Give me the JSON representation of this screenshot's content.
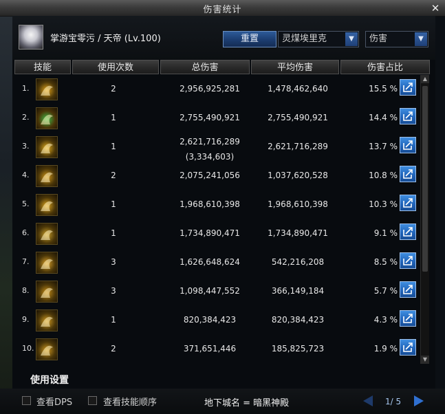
{
  "window": {
    "title": "伤害统计",
    "close_label": "✕"
  },
  "header": {
    "character": "掌游宝零污 / 天帝 (Lv.100)",
    "reset_label": "重置",
    "target_select": "灵煤埃里克",
    "metric_select": "伤害",
    "dropdown_arrow": "▼"
  },
  "table": {
    "columns": [
      "技能",
      "使用次数",
      "总伤害",
      "平均伤害",
      "伤害占比"
    ],
    "rows": [
      {
        "rank": "1.",
        "uses": "2",
        "total": "2,956,925,281",
        "total_extra": "",
        "avg": "1,478,462,640",
        "pct": "15.5 %",
        "icon": "flame-slash-icon",
        "color": "#e2a51c"
      },
      {
        "rank": "2.",
        "uses": "1",
        "total": "2,755,490,921",
        "total_extra": "",
        "avg": "2,755,490,921",
        "pct": "14.4 %",
        "icon": "green-lightning-icon",
        "color": "#3fc04a"
      },
      {
        "rank": "3.",
        "uses": "1",
        "total": "2,621,716,289",
        "total_extra": "(3,334,603)",
        "avg": "2,621,716,289",
        "pct": "13.7 %",
        "icon": "storm-strike-icon",
        "color": "#e6b020"
      },
      {
        "rank": "4.",
        "uses": "2",
        "total": "2,075,241,056",
        "total_extra": "",
        "avg": "1,037,620,528",
        "pct": "10.8 %",
        "icon": "wave-arrow-icon",
        "color": "#d49a1a"
      },
      {
        "rank": "5.",
        "uses": "1",
        "total": "1,968,610,398",
        "total_extra": "",
        "avg": "1,968,610,398",
        "pct": "10.3 %",
        "icon": "crown-burst-icon",
        "color": "#e0a820"
      },
      {
        "rank": "6.",
        "uses": "1",
        "total": "1,734,890,471",
        "total_extra": "",
        "avg": "1,734,890,471",
        "pct": "9.1 %",
        "icon": "triple-wave-icon",
        "color": "#caa02a"
      },
      {
        "rank": "7.",
        "uses": "3",
        "total": "1,626,648,624",
        "total_extra": "",
        "avg": "542,216,208",
        "pct": "8.5 %",
        "icon": "pillar-glow-icon",
        "color": "#dca22a"
      },
      {
        "rank": "8.",
        "uses": "3",
        "total": "1,098,447,552",
        "total_extra": "",
        "avg": "366,149,184",
        "pct": "5.7 %",
        "icon": "rune-circle-icon",
        "color": "#c99018"
      },
      {
        "rank": "9.",
        "uses": "1",
        "total": "820,384,423",
        "total_extra": "",
        "avg": "820,384,423",
        "pct": "4.3 %",
        "icon": "sun-face-icon",
        "color": "#d6a024"
      },
      {
        "rank": "10.",
        "uses": "2",
        "total": "371,651,446",
        "total_extra": "",
        "avg": "185,825,723",
        "pct": "1.9 %",
        "icon": "spiral-orb-icon",
        "color": "#d09a22"
      }
    ]
  },
  "settings": {
    "label": "使用设置"
  },
  "footer": {
    "show_dps": "查看DPS",
    "show_order": "查看技能顺序",
    "dungeon": "地下城名 = 暗黑神殿",
    "page": "1/ 5"
  }
}
